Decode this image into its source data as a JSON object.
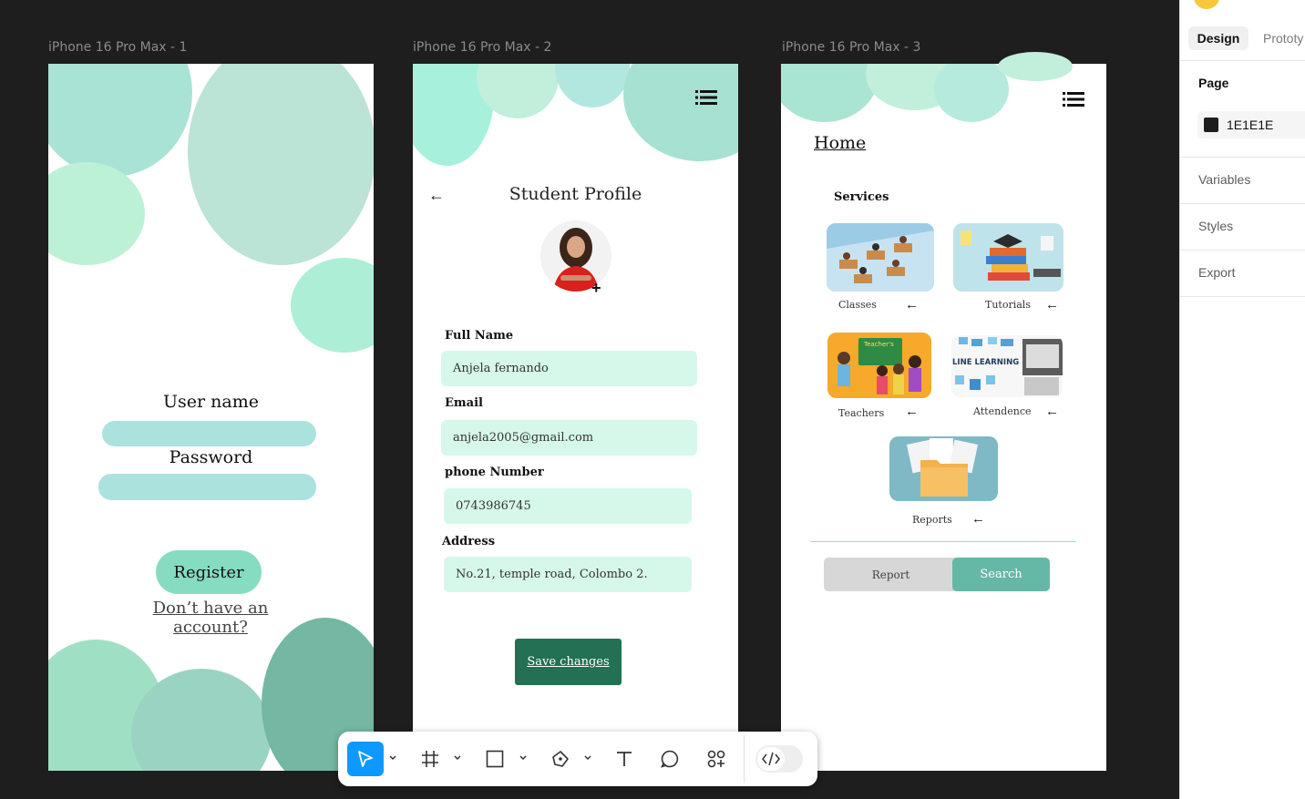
{
  "canvas": {
    "background": "#1E1E1E",
    "frames": [
      {
        "title": "iPhone 16 Pro Max - 1"
      },
      {
        "title": "iPhone 16 Pro Max - 2"
      },
      {
        "title": "iPhone 16 Pro Max - 3"
      }
    ]
  },
  "login": {
    "username_label": "User name",
    "password_label": "Password",
    "register_label": "Register",
    "account_link": "Don’t have an account?"
  },
  "profile": {
    "title": "Student Profile",
    "fields": [
      {
        "label": "Full Name",
        "value": "Anjela fernando"
      },
      {
        "label": "Email",
        "value": "anjela2005@gmail.com"
      },
      {
        "label": "phone Number",
        "value": "0743986745"
      },
      {
        "label": "Address",
        "value": "No.21, temple road, Colombo 2."
      }
    ],
    "save_label": "Save changes"
  },
  "home": {
    "title": "Home",
    "services_heading": "Services",
    "cards": [
      {
        "label": "Classes"
      },
      {
        "label": "Tutorials"
      },
      {
        "label": "Teachers",
        "image_text": "Teacher's"
      },
      {
        "label": "Attendence",
        "image_text": "LINE LEARNING"
      },
      {
        "label": "Reports"
      }
    ],
    "segment": {
      "report_label": "Report",
      "search_label": "Search"
    }
  },
  "toolbar": {
    "tools": [
      "move-tool",
      "frame-tool",
      "shape-tool",
      "pen-tool",
      "text-tool",
      "comment-tool",
      "actions-tool",
      "dev-mode-toggle"
    ]
  },
  "panel": {
    "tabs": {
      "design": "Design",
      "prototype": "Prototy"
    },
    "page_heading": "Page",
    "page_color": "1E1E1E",
    "sections": {
      "variables": "Variables",
      "styles": "Styles",
      "export": "Export"
    }
  },
  "colors": {
    "mint_light": "#D6F8EA",
    "mint": "#ABE2DD",
    "register": "#86DCC0",
    "save": "#237055",
    "search": "#66B8A6",
    "accent_blue": "#0D99FF"
  }
}
